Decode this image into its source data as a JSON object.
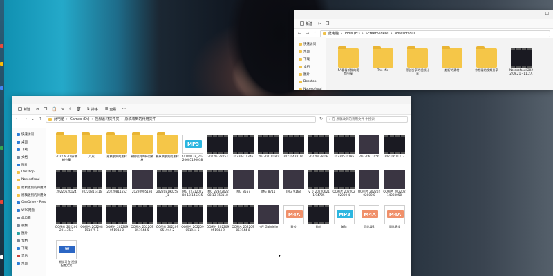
{
  "colors": {
    "accent": "#2f7fd6",
    "folder": "#f5c648",
    "green_block": "#7ec21e"
  },
  "window_back": {
    "toolbar": {
      "new_label": "新建"
    },
    "address": {
      "segments": [
        "此电脑",
        "Tools (E:)",
        "ScreenVideos",
        "Notesofsoul"
      ]
    },
    "sidebar": [
      {
        "label": "快速访问",
        "icon": "star-icon"
      },
      {
        "label": "桌面",
        "icon": "desktop-icon"
      },
      {
        "label": "下载",
        "icon": "download-icon"
      },
      {
        "label": "文档",
        "icon": "document-icon"
      },
      {
        "label": "图片",
        "icon": "picture-icon"
      },
      {
        "label": "Desktop",
        "icon": "folder-icon"
      },
      {
        "label": "Notesofsoul",
        "icon": "folder-icon"
      }
    ],
    "items": [
      {
        "type": "folder",
        "label": "5A看看新鲜的视频分享"
      },
      {
        "type": "folder",
        "label": "The Mix"
      },
      {
        "type": "folder",
        "label": "原创分享的视频分享"
      },
      {
        "type": "folder",
        "label": "超好的素材"
      },
      {
        "type": "folder",
        "label": "你想看的视频分享"
      },
      {
        "type": "video",
        "label": "Notesofsoul 2022.09.21 - 11.27.41.01"
      }
    ]
  },
  "window_front": {
    "toolbar": {
      "new_label": "新建",
      "sort_label": "排序",
      "view_label": "查看"
    },
    "address": {
      "segments": [
        "此电脑",
        "Games (D:)",
        "视频素材文件夹",
        "原稿收到的待用文件"
      ]
    },
    "search_placeholder": "在 原稿收到的待用文件 中搜索",
    "sidebar": [
      {
        "label": "快速访问",
        "icon": "star-icon",
        "cls": "blue"
      },
      {
        "label": "桌面",
        "icon": "desktop-icon",
        "cls": "blue"
      },
      {
        "label": "下载",
        "icon": "download-icon",
        "cls": "blue"
      },
      {
        "label": "文档",
        "icon": "document-icon",
        "cls": "gray"
      },
      {
        "label": "图片",
        "icon": "picture-icon",
        "cls": "blue"
      },
      {
        "label": "Desktop",
        "icon": "folder-icon",
        "cls": ""
      },
      {
        "label": "Notesofsoul",
        "icon": "folder-icon",
        "cls": ""
      },
      {
        "label": "原稿收到的待用文件",
        "icon": "folder-icon",
        "cls": ""
      },
      {
        "label": "原稿收到的待用文件",
        "icon": "folder-icon",
        "cls": ""
      },
      {
        "label": "OneDrive - Pers",
        "icon": "cloud-icon",
        "cls": "blue"
      },
      {
        "label": "WPS网盘",
        "icon": "cloud-icon",
        "cls": "blue"
      },
      {
        "label": "此电脑",
        "icon": "pc-icon",
        "cls": "gray"
      },
      {
        "label": "视频",
        "icon": "video-icon",
        "cls": "gray"
      },
      {
        "label": "图片",
        "icon": "picture-icon",
        "cls": "teal"
      },
      {
        "label": "文档",
        "icon": "document-icon",
        "cls": "gray"
      },
      {
        "label": "下载",
        "icon": "download-icon",
        "cls": "blue"
      },
      {
        "label": "音乐",
        "icon": "music-icon",
        "cls": "red"
      },
      {
        "label": "桌面",
        "icon": "desktop-icon",
        "cls": "blue"
      }
    ],
    "rows": [
      [
        {
          "type": "folder",
          "label": "2022.6.20 原稿 新分集"
        },
        {
          "type": "folder",
          "label": "八尺"
        },
        {
          "type": "folder",
          "label": "原稿收到的素材"
        },
        {
          "type": "folder",
          "label": "原稿收到的待用素材"
        },
        {
          "type": "folder",
          "label": "新原稿收到的素材"
        },
        {
          "type": "mp3",
          "label": "44104128_20220605190038"
        },
        {
          "type": "video",
          "label": "20220322053"
        },
        {
          "type": "video",
          "label": "20220411346"
        },
        {
          "type": "video",
          "label": "20220418180"
        },
        {
          "type": "video",
          "label": "20220428190"
        },
        {
          "type": "video",
          "label": "20220428194"
        },
        {
          "type": "video",
          "label": "20220520185"
        },
        {
          "type": "image",
          "label": "20220611056"
        },
        {
          "type": "video",
          "label": "20220611377"
        }
      ],
      [
        {
          "type": "video",
          "label": "20220620124"
        },
        {
          "type": "video",
          "label": "20220811416"
        },
        {
          "type": "video",
          "label": "20220811552"
        },
        {
          "type": "image",
          "label": "20220905194"
        },
        {
          "type": "video",
          "label": "202208190258_1"
        },
        {
          "type": "video",
          "label": "IMG_2231202208 13-145235"
        },
        {
          "type": "video",
          "label": "IMG_2234202208 13-153118"
        },
        {
          "type": "image",
          "label": "IMG_8557"
        },
        {
          "type": "image",
          "label": "IMG_8711"
        },
        {
          "type": "image",
          "label": "IMG_9168"
        },
        {
          "type": "video",
          "label": "lv_0_202206211 94705"
        },
        {
          "type": "video",
          "label": "QQ图片 20220202000 4"
        },
        {
          "type": "image",
          "label": "QQ图片 20220202000 0"
        },
        {
          "type": "image",
          "label": "QQ图片 20220214003050"
        }
      ],
      [
        {
          "type": "video",
          "label": "QQ图片 202206201475 3"
        },
        {
          "type": "video",
          "label": "QQ图片 202208151075 6"
        },
        {
          "type": "video",
          "label": "QQ图片 202209051944 0"
        },
        {
          "type": "video",
          "label": "QQ图片 202209051944 5"
        },
        {
          "type": "video",
          "label": "QQ图片 202209051944 2"
        },
        {
          "type": "video",
          "label": "QQ图片 202209051944 5"
        },
        {
          "type": "video",
          "label": "QQ图片 202209051944 9"
        },
        {
          "type": "video",
          "label": "QQ图片 202209051944 8"
        },
        {
          "type": "image",
          "label": "八尺 Gabrielle"
        },
        {
          "type": "m4a",
          "label": "番长"
        },
        {
          "type": "video",
          "label": "动态"
        },
        {
          "type": "mp3",
          "label": "破防"
        },
        {
          "type": "m4a",
          "label": "同比表2"
        },
        {
          "type": "m4a",
          "label": "同比表4"
        }
      ],
      [
        {
          "type": "docx",
          "label": "一期学习会 视频 配置文案"
        }
      ]
    ]
  }
}
